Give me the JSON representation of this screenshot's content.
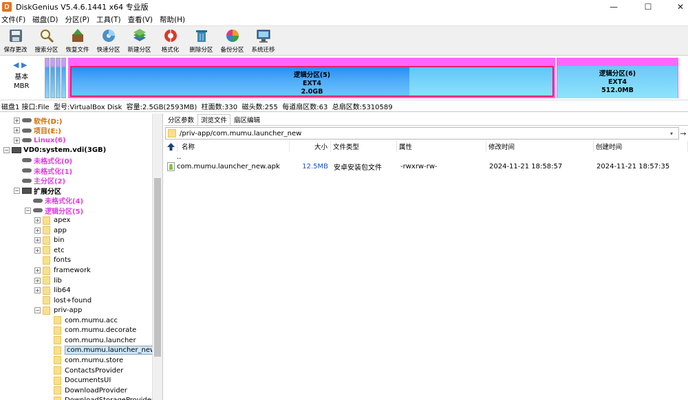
{
  "window": {
    "title": "DiskGenius V5.4.6.1441 x64 专业版",
    "icon_letter": "D",
    "minimize": "—",
    "maximize": "☐",
    "close": "✕"
  },
  "menu": [
    "文件(F)",
    "磁盘(D)",
    "分区(P)",
    "工具(T)",
    "查看(V)",
    "帮助(H)"
  ],
  "toolbar": [
    {
      "label": "保存更改",
      "icon": "save-icon"
    },
    {
      "label": "搜索分区",
      "icon": "search-icon"
    },
    {
      "label": "恢复文件",
      "icon": "recover-icon"
    },
    {
      "label": "快速分区",
      "icon": "quick-partition-icon"
    },
    {
      "label": "新建分区",
      "icon": "new-partition-icon"
    },
    {
      "label": "格式化",
      "icon": "format-icon"
    },
    {
      "label": "删除分区",
      "icon": "delete-icon"
    },
    {
      "label": "备份分区",
      "icon": "backup-icon"
    },
    {
      "label": "系统迁移",
      "icon": "migrate-icon"
    }
  ],
  "disk_map": {
    "nav_left": "◀",
    "nav_right": "▶",
    "disk_type_line1": "基本",
    "disk_type_line2": "MBR",
    "main": {
      "name": "逻辑分区(5)",
      "fs": "EXT4",
      "size": "2.0GB"
    },
    "right": {
      "name": "逻辑分区(6)",
      "fs": "EXT4",
      "size": "512.0MB"
    }
  },
  "info_line": "磁盘1 接口:File  型号:VirtualBox Disk  容量:2.5GB(2593MB)  柱面数:330  磁头数:255  每道扇区数:63  总扇区数:5310589",
  "tree": [
    {
      "label": "软件(D:)",
      "style": "orange",
      "indent": 20,
      "exp": "+",
      "icon": "disk"
    },
    {
      "label": "项目(E:)",
      "style": "orange",
      "indent": 20,
      "exp": "+",
      "icon": "disk"
    },
    {
      "label": "Linux(6)",
      "style": "magenta",
      "indent": 20,
      "exp": "+",
      "icon": "disk"
    },
    {
      "label": "VD0:system.vdi(3GB)",
      "style": "bold",
      "indent": 5,
      "exp": "−",
      "icon": "hdd"
    },
    {
      "label": "未格式化(0)",
      "style": "magenta",
      "indent": 20,
      "exp": "",
      "icon": "disk"
    },
    {
      "label": "未格式化(1)",
      "style": "magenta",
      "indent": 20,
      "exp": "",
      "icon": "disk"
    },
    {
      "label": "主分区(2)",
      "style": "magenta",
      "indent": 20,
      "exp": "",
      "icon": "disk"
    },
    {
      "label": "扩展分区",
      "style": "bold",
      "indent": 20,
      "exp": "−",
      "icon": "hdd"
    },
    {
      "label": "未格式化(4)",
      "style": "magenta",
      "indent": 36,
      "exp": "",
      "icon": "disk"
    },
    {
      "label": "逻辑分区(5)",
      "style": "magenta",
      "indent": 36,
      "exp": "−",
      "icon": "disk"
    },
    {
      "label": "apex",
      "style": "",
      "indent": 50,
      "exp": "+",
      "icon": "folder"
    },
    {
      "label": "app",
      "style": "",
      "indent": 50,
      "exp": "+",
      "icon": "folder"
    },
    {
      "label": "bin",
      "style": "",
      "indent": 50,
      "exp": "+",
      "icon": "folder"
    },
    {
      "label": "etc",
      "style": "",
      "indent": 50,
      "exp": "+",
      "icon": "folder"
    },
    {
      "label": "fonts",
      "style": "",
      "indent": 50,
      "exp": "",
      "icon": "folder"
    },
    {
      "label": "framework",
      "style": "",
      "indent": 50,
      "exp": "+",
      "icon": "folder"
    },
    {
      "label": "lib",
      "style": "",
      "indent": 50,
      "exp": "+",
      "icon": "folder"
    },
    {
      "label": "lib64",
      "style": "",
      "indent": 50,
      "exp": "+",
      "icon": "folder"
    },
    {
      "label": "lost+found",
      "style": "",
      "indent": 50,
      "exp": "",
      "icon": "folder"
    },
    {
      "label": "priv-app",
      "style": "",
      "indent": 50,
      "exp": "−",
      "icon": "folder"
    },
    {
      "label": "com.mumu.acc",
      "style": "",
      "indent": 66,
      "exp": "",
      "icon": "folder"
    },
    {
      "label": "com.mumu.decorate",
      "style": "",
      "indent": 66,
      "exp": "",
      "icon": "folder"
    },
    {
      "label": "com.mumu.launcher",
      "style": "",
      "indent": 66,
      "exp": "",
      "icon": "folder"
    },
    {
      "label": "com.mumu.launcher_new",
      "style": "sel",
      "indent": 66,
      "exp": "",
      "icon": "folder"
    },
    {
      "label": "com.mumu.store",
      "style": "",
      "indent": 66,
      "exp": "",
      "icon": "folder"
    },
    {
      "label": "ContactsProvider",
      "style": "",
      "indent": 66,
      "exp": "",
      "icon": "folder"
    },
    {
      "label": "DocumentsUI",
      "style": "",
      "indent": 66,
      "exp": "",
      "icon": "folder"
    },
    {
      "label": "DownloadProvider",
      "style": "",
      "indent": 66,
      "exp": "",
      "icon": "folder"
    },
    {
      "label": "DownloadStorageProvider",
      "style": "",
      "indent": 66,
      "exp": "",
      "icon": "folder"
    }
  ],
  "tabs": [
    "分区参数",
    "浏览文件",
    "扇区编辑"
  ],
  "path": "/priv-app/com.mumu.launcher_new",
  "path_go": "→",
  "columns": {
    "name": "名称",
    "size": "大小",
    "type": "文件类型",
    "attr": "属性",
    "mtime": "修改时间",
    "ctime": "创建时间"
  },
  "files": [
    {
      "name": "..",
      "size": "",
      "type": "",
      "attr": "",
      "mtime": "",
      "ctime": ""
    },
    {
      "name": "com.mumu.launcher_new.apk",
      "size": "12.5MB",
      "type": "安卓安装包文件",
      "attr": "-rwxrw-rw-",
      "mtime": "2024-11-21 18:58:57",
      "ctime": "2024-11-21 18:57:35"
    }
  ]
}
